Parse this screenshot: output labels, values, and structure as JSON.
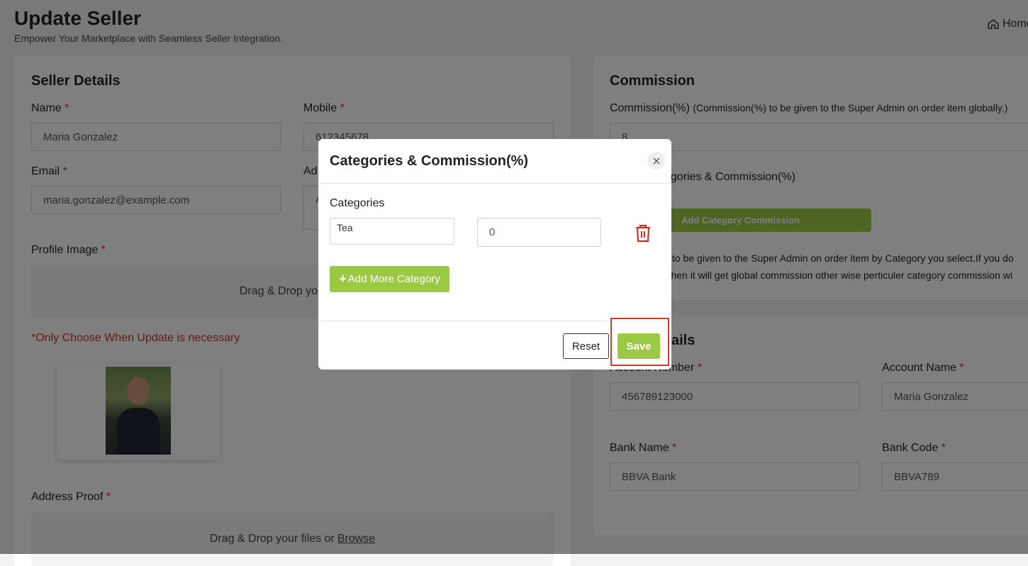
{
  "header": {
    "title": "Update Seller",
    "subtitle": "Empower Your Marketplace with Seamless Seller Integration.",
    "home_label": "Home"
  },
  "seller_details": {
    "title": "Seller Details",
    "name_label": "Name",
    "name_value": "Maria Gonzalez",
    "mobile_label": "Mobile",
    "mobile_value": "612345678",
    "email_label": "Email",
    "email_value": "maria.gonzalez@example.com",
    "address_label": "Ad",
    "address_value": "A",
    "profile_image_label": "Profile Image",
    "dropzone_text": "Drag & Drop your files or",
    "browse_label": "Browse",
    "profile_dropzone_visible": "Drag & Drop your file",
    "update_note": "*Only Choose When Update is necessary",
    "address_proof_label": "Address Proof",
    "required_mark": "*"
  },
  "commission": {
    "title": "Commission",
    "label": "Commission(%)",
    "hint": "(Commission(%) to be given to the Super Admin on order item globally.)",
    "value": "8",
    "category_label": "egories & Commission(%)",
    "add_button": "Add Category Commission",
    "info_line1": "%) to be given to the Super Admin on order item by Category you select.If you do",
    "info_line2": "ry then it will get global commission other wise perticuler category commission wi"
  },
  "bank_details": {
    "title_visible": "ails",
    "account_number_label": "Account Number",
    "account_number_value": "456789123000",
    "account_name_label": "Account Name",
    "account_name_value": "Maria Gonzalez",
    "bank_name_label": "Bank Name",
    "bank_name_value": "BBVA Bank",
    "bank_code_label": "Bank Code",
    "bank_code_value": "BBVA789"
  },
  "modal": {
    "title": "Categories & Commission(%)",
    "categories_label": "Categories",
    "category_selected": "Tea",
    "commission_value": "0",
    "add_more_label": "Add More Category",
    "reset_label": "Reset",
    "save_label": "Save"
  },
  "colors": {
    "accent_green": "#9bc944",
    "required_red": "#c0392b",
    "highlight_red": "#d93a2e",
    "trash_red": "#c0392b"
  }
}
